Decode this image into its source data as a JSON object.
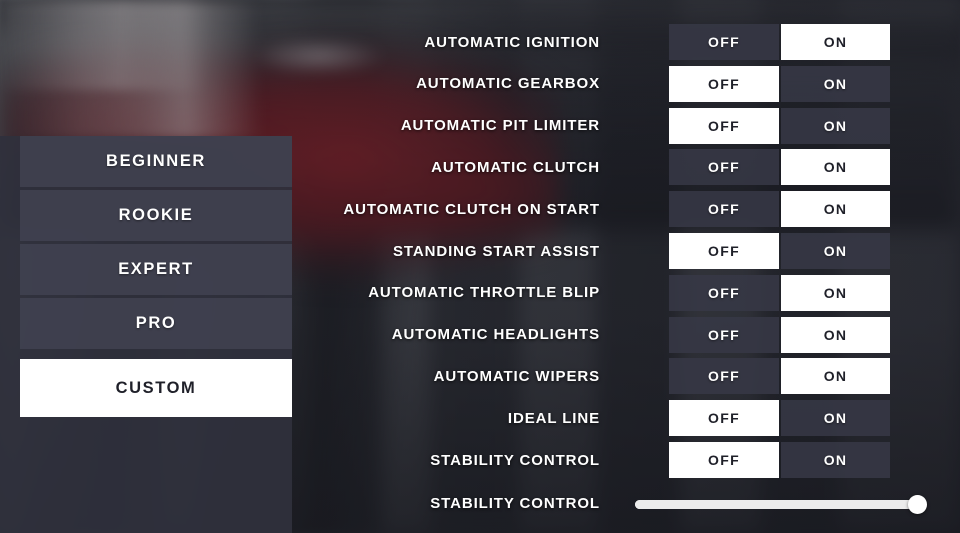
{
  "presets": {
    "items": [
      {
        "label": "BEGINNER",
        "selected": false
      },
      {
        "label": "ROOKIE",
        "selected": false
      },
      {
        "label": "EXPERT",
        "selected": false
      },
      {
        "label": "PRO",
        "selected": false
      },
      {
        "label": "CUSTOM",
        "selected": true
      }
    ]
  },
  "toggle_labels": {
    "off": "OFF",
    "on": "ON"
  },
  "settings": {
    "rows": [
      {
        "label": "AUTOMATIC IGNITION",
        "value": "ON"
      },
      {
        "label": "AUTOMATIC GEARBOX",
        "value": "OFF"
      },
      {
        "label": "AUTOMATIC PIT LIMITER",
        "value": "OFF"
      },
      {
        "label": "AUTOMATIC CLUTCH",
        "value": "ON"
      },
      {
        "label": "AUTOMATIC CLUTCH ON START",
        "value": "ON"
      },
      {
        "label": "STANDING START ASSIST",
        "value": "OFF"
      },
      {
        "label": "AUTOMATIC THROTTLE BLIP",
        "value": "ON"
      },
      {
        "label": "AUTOMATIC HEADLIGHTS",
        "value": "ON"
      },
      {
        "label": "AUTOMATIC WIPERS",
        "value": "ON"
      },
      {
        "label": "IDEAL LINE",
        "value": "OFF"
      },
      {
        "label": "STABILITY CONTROL",
        "value": "OFF"
      }
    ]
  },
  "slider": {
    "label": "STABILITY CONTROL",
    "percent": 100
  },
  "colors": {
    "panel": "#2f303c",
    "button": "#424352",
    "selected_bg": "#ffffff",
    "selected_text": "#1f2029",
    "text": "#ffffff"
  }
}
